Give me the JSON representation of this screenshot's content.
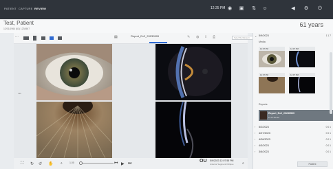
{
  "nav": {
    "tabs": [
      "PATIENT",
      "CAPTURE",
      "REVIEW"
    ],
    "active_tab": "REVIEW",
    "time": "12:25 PM"
  },
  "patient": {
    "name": "Test, Patient",
    "dob_id": "12/01/1964 (61)   1234567",
    "age": "61 years"
  },
  "viewer": {
    "report_title": "Report_Ex2_20230509",
    "export_placeholder": "Select/Sort/Export ...",
    "label_bottom_left": "Info",
    "zoom": "1.00",
    "eye": "OU",
    "datetime": "5/9/2023 12:07:55 PM",
    "description": "Anterior Segment Oblique"
  },
  "history": {
    "top_date": "5/9/2023",
    "top_counts": "1  1  7",
    "media_label": "Media",
    "thumbs": [
      {
        "time": "12:07 PM",
        "extra": "OD"
      },
      {
        "time": "12:07 PM",
        "extra": "OS"
      },
      {
        "time": "12:07 PM",
        "extra": "OD"
      },
      {
        "time": "12:07 PM",
        "extra": "OS"
      }
    ],
    "reports_label": "Reports",
    "report_item": {
      "title": "Report_Ex2_20230509",
      "sub": "12:07:55 PM"
    },
    "dates": [
      {
        "date": "5/2/2023",
        "counts": "0  0  1"
      },
      {
        "date": "4/27/2023",
        "counts": "0  0  1"
      },
      {
        "date": "4/26/2023",
        "counts": "0  0  1"
      },
      {
        "date": "4/3/2023",
        "counts": "0  0  1"
      },
      {
        "date": "3/6/2023",
        "counts": "0  0  1"
      }
    ],
    "patient_button": "Patient"
  }
}
